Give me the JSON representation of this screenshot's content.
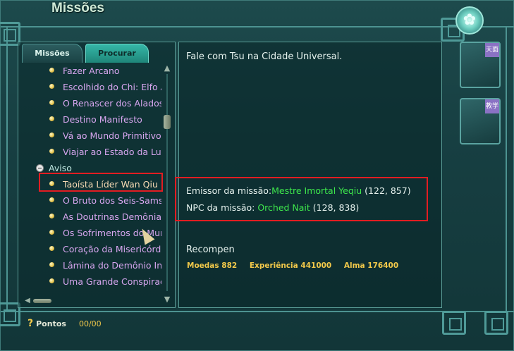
{
  "window": {
    "title": "Missões",
    "flower_glyph": "✿"
  },
  "tabs": [
    {
      "label": "Missões"
    },
    {
      "label": "Procurar"
    }
  ],
  "quest_list": {
    "group1": [
      "Fazer Arcano",
      "Escolhido do Chi: Elfo Ala",
      "O Renascer dos Alados",
      "Destino Manifesto",
      "Vá ao Mundo Primitivo",
      "Viajar ao Estado da Lua"
    ],
    "category": "Aviso",
    "selected": "Taoísta Líder Wan Qiu",
    "group2": [
      "O Bruto dos Seis-Samsa",
      "As Doutrinas Demôniaca",
      "Os Sofrimentos do Mund",
      "Coração da Misericórdi",
      "Lâmina do Demônio Insa",
      "Uma Grande Conspiraçã"
    ]
  },
  "details": {
    "description": "Fale com Tsu na Cidade Universal.",
    "issuer_label": "Emissor da missão:",
    "issuer_name": "Mestre Imortal Yeqiu",
    "issuer_coords": "(122, 857)",
    "npc_label": "NPC da missão: ",
    "npc_name": "Orched Nait",
    "npc_coords": "(128, 838)",
    "reward_title": "Recompen",
    "rewards": {
      "coins": "Moedas 882",
      "experience": "Experiência 441000",
      "soul": "Alma 176400"
    }
  },
  "footer": {
    "help_glyph": "?",
    "points_label": "Pontos",
    "points_value": "00/00"
  },
  "side_tabs": [
    {
      "badge": "天面"
    },
    {
      "badge": "教学"
    }
  ],
  "colors": {
    "highlight_box": "#e21d22",
    "quest_text": "#d7a6ef",
    "npc_name": "#3ee84c",
    "reward_text": "#f2c94a"
  }
}
